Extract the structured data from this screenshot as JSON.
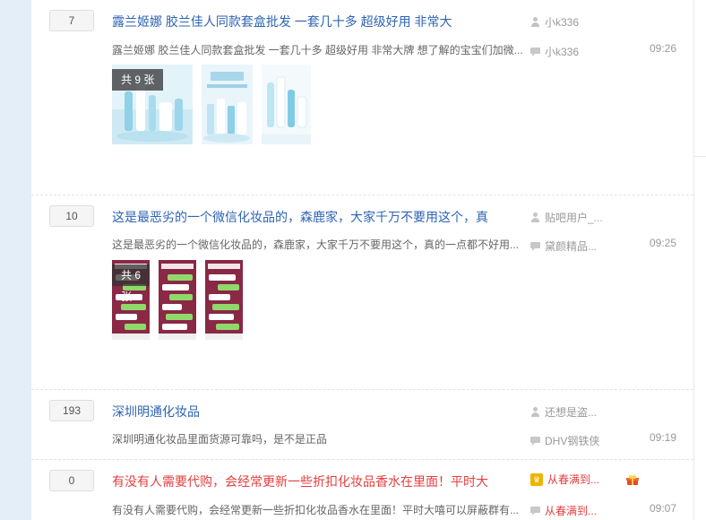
{
  "threads": [
    {
      "reply_count": "7",
      "title": "露兰姬娜 胶兰佳人同款套盒批发 一套几十多 超级好用 非常大",
      "abstract": "露兰姬娜 胶兰佳人同款套盒批发 一套几十多 超级好用 非常大牌 想了解的宝宝们加微...",
      "author": "小k336",
      "last_reply_user": "小k336",
      "time": "09:26",
      "image_count": "共 9 张"
    },
    {
      "reply_count": "10",
      "title": "这是最恶劣的一个微信化妆品的，森鹿家，大家千万不要用这个，真",
      "abstract": "这是最恶劣的一个微信化妆品的，森鹿家，大家千万不要用这个，真的一点都不好用...",
      "author": "贴吧用户_...",
      "last_reply_user": "黛颜精品...",
      "time": "09:25",
      "image_count": "共 6 张"
    },
    {
      "reply_count": "193",
      "title": "深圳明通化妆品",
      "abstract": "深圳明通化妆品里面货源可靠吗，是不是正品",
      "author": "还想是盗...",
      "last_reply_user": "DHV钢铁侠",
      "time": "09:19"
    },
    {
      "reply_count": "0",
      "title": "有没有人需要代购，会经常更新一些折扣化妆品香水在里面！平时大",
      "abstract": "有没有人需要代购，会经常更新一些折扣化妆品香水在里面！平时大嘻可以屏蔽群有...",
      "author": "从春满到...",
      "last_reply_user": "从春满到...",
      "time": "09:07"
    }
  ],
  "icons": {
    "author": "user-icon",
    "last_reply": "reply-icon",
    "member_badge": "vip-badge-icon",
    "gift": "gift-icon"
  },
  "colors": {
    "title_link": "#2d64b3",
    "promoted_title": "#e53e3e",
    "left_strip": "#e4eef8"
  }
}
